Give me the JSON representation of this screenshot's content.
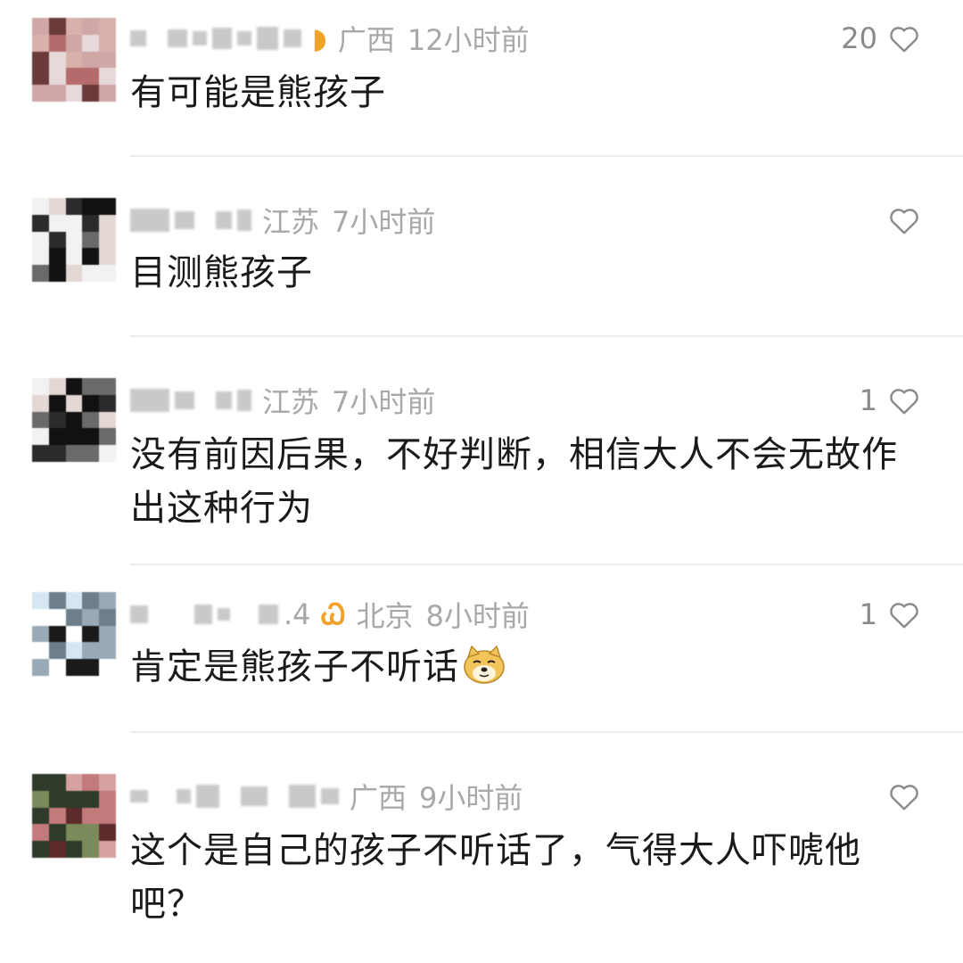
{
  "comments": [
    {
      "location": "广西",
      "time": "12小时前",
      "likes": "20",
      "badge": "◗",
      "text": "有可能是熊孩子",
      "avatar_palette": [
        "#cfa7a7",
        "#b56b6b",
        "#d8b1ab",
        "#6b3a3a",
        "#e7d9d9"
      ]
    },
    {
      "location": "江苏",
      "time": "7小时前",
      "likes": "",
      "text": "目测熊孩子",
      "avatar_palette": [
        "#f2f2f2",
        "#111111",
        "#6a6a6a",
        "#e3d8d4",
        "#2b2b2b"
      ]
    },
    {
      "location": "江苏",
      "time": "7小时前",
      "likes": "1",
      "text": "没有前因后果，不好判断，相信大人不会无故作出这种行为",
      "avatar_palette": [
        "#f2f2f2",
        "#111111",
        "#6a6a6a",
        "#e3d8d4",
        "#2b2b2b"
      ]
    },
    {
      "name_tail": ".4",
      "badge": "Ꮗ",
      "location": "北京",
      "time": "8小时前",
      "likes": "1",
      "text": "肯定是熊孩子不听话",
      "emoji": "doge",
      "avatar_palette": [
        "#d5e7f2",
        "#97aab6",
        "#ffffff",
        "#6c7f8a",
        "#1a1a1a"
      ]
    },
    {
      "location": "广西",
      "time": "9小时前",
      "likes": "",
      "text": "这个是自己的孩子不听话了，气得大人吓唬他吧？",
      "avatar_palette": [
        "#5b2a2a",
        "#7a8a5a",
        "#d6a1a1",
        "#2e3a2a",
        "#c27a7a"
      ]
    }
  ]
}
